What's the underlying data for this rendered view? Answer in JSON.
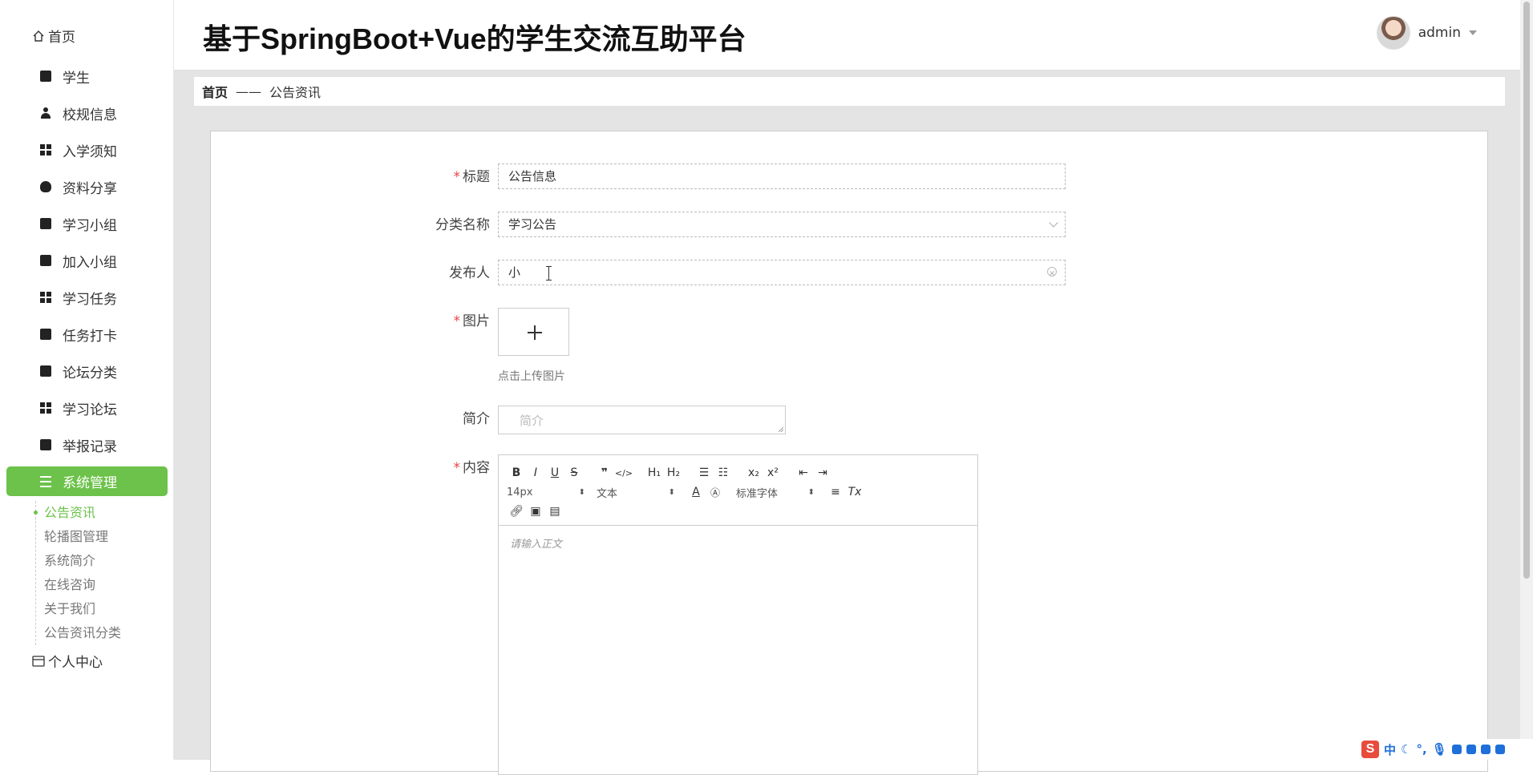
{
  "sidebar": {
    "home": "首页",
    "items": [
      {
        "label": "学生",
        "icon": "video-icon"
      },
      {
        "label": "校规信息",
        "icon": "user-icon"
      },
      {
        "label": "入学须知",
        "icon": "grid-icon"
      },
      {
        "label": "资料分享",
        "icon": "bulb-icon"
      },
      {
        "label": "学习小组",
        "icon": "briefcase-icon"
      },
      {
        "label": "加入小组",
        "icon": "clipboard-icon"
      },
      {
        "label": "学习任务",
        "icon": "grid-icon"
      },
      {
        "label": "任务打卡",
        "icon": "monitor-icon"
      },
      {
        "label": "论坛分类",
        "icon": "check-clipboard-icon"
      },
      {
        "label": "学习论坛",
        "icon": "grid-icon"
      },
      {
        "label": "举报记录",
        "icon": "wallet-icon"
      },
      {
        "label": "系统管理",
        "icon": "list-icon",
        "active": true
      }
    ],
    "sub_items": [
      "公告资讯",
      "轮播图管理",
      "系统简介",
      "在线咨询",
      "关于我们",
      "公告资讯分类"
    ],
    "personal": "个人中心"
  },
  "header": {
    "title": "基于SpringBoot+Vue的学生交流互助平台",
    "username": "admin"
  },
  "breadcrumb": {
    "home": "首页",
    "separator": "——",
    "current": "公告资讯"
  },
  "form": {
    "title_label": "标题",
    "title_value": "公告信息",
    "category_label": "分类名称",
    "category_value": "学习公告",
    "publisher_label": "发布人",
    "publisher_value": "小",
    "image_label": "图片",
    "upload_tip": "点击上传图片",
    "intro_label": "简介",
    "intro_placeholder": "简介",
    "content_label": "内容",
    "editor": {
      "font_size": "14px",
      "text_type": "文本",
      "font_family": "标准字体",
      "placeholder": "请输入正文"
    }
  },
  "ime": {
    "lang": "中"
  }
}
